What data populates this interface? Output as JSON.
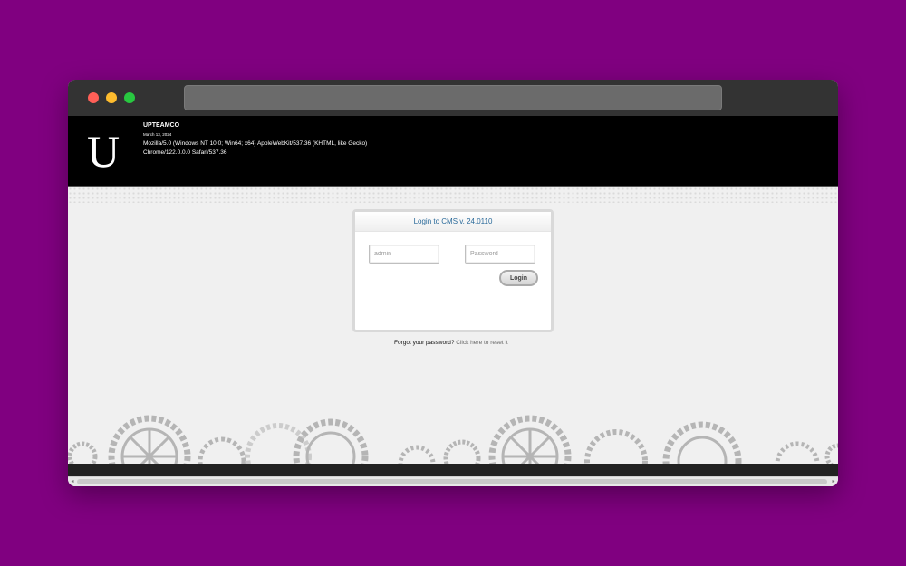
{
  "browser": {
    "url": ""
  },
  "site": {
    "logo_letter": "U",
    "name": "UPTEAMCO",
    "date": "March 13, 2024",
    "user_agent": "Mozilla/5.0 (Windows NT 10.0; Win64; x64) AppleWebKit/537.36 (KHTML, like Gecko) Chrome/122.0.0.0 Safari/537.36"
  },
  "login": {
    "title": "Login to CMS v. 24.0110",
    "username_placeholder": "admin",
    "password_placeholder": "Password",
    "button_label": "Login",
    "forgot_text": "Forgot your password?",
    "reset_link": "Click here to reset it"
  },
  "colors": {
    "background": "#800080",
    "header": "#000000",
    "accent": "#2a6a9a"
  }
}
